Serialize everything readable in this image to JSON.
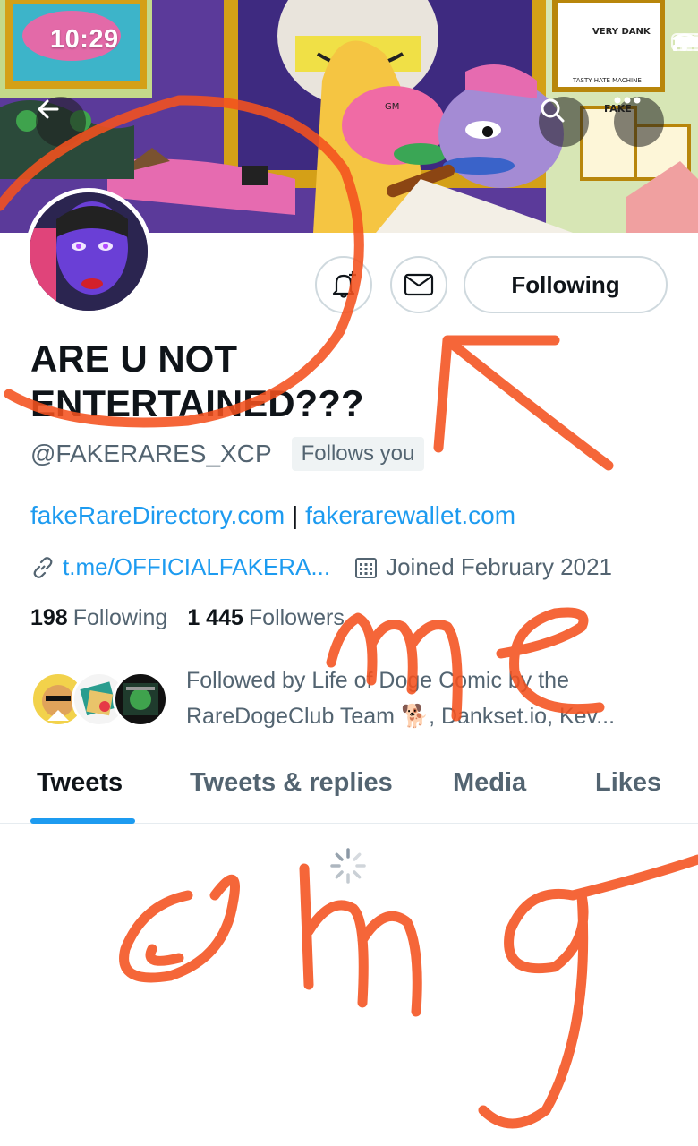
{
  "status_bar": {
    "time": "10:29"
  },
  "banner": {
    "sign_text_1": "VERY DANK",
    "sign_text_2": "FAKE",
    "sign_text_3": "GM",
    "sign_text_4": "TASTY HATE MACHINE"
  },
  "profile": {
    "display_name": "ARE U NOT ENTERTAINED???",
    "handle": "@FAKERARES_XCP",
    "follows_you": "Follows you",
    "bio_link_1": "fakeRareDirectory.com",
    "bio_separator": " | ",
    "bio_link_2": "fakerarewallet.com",
    "website": "t.me/OFFICIALFAKERA...",
    "joined": "Joined February 2021",
    "following_count": "198",
    "following_label": "Following",
    "followers_count": "1 445",
    "followers_label": "Followers",
    "followed_by": "Followed by Life of Doge Comic by the RareDogeClub Team 🐕, Dankset.io, Kev..."
  },
  "actions": {
    "following_button": "Following"
  },
  "tabs": [
    {
      "label": "Tweets"
    },
    {
      "label": "Tweets & replies"
    },
    {
      "label": "Media"
    },
    {
      "label": "Likes"
    }
  ],
  "colors": {
    "accent": "#1d9bf0",
    "scribble": "#f4511e"
  }
}
